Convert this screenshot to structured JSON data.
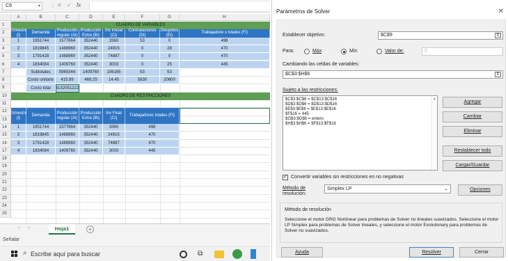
{
  "formula_bar": {
    "name_box": "C9",
    "fx": "fx"
  },
  "columns": [
    "A",
    "B",
    "C",
    "D",
    "E",
    "F",
    "G",
    "H"
  ],
  "rows": [
    "1",
    "2",
    "3",
    "4",
    "5",
    "6",
    "7",
    "8",
    "9",
    "10",
    "11",
    "12",
    "13",
    "14",
    "15",
    "16",
    "17",
    "18",
    "19",
    "20",
    "21",
    "22",
    "23",
    "24",
    "25"
  ],
  "table1": {
    "band": "CUADRO DE VARIABLES",
    "headers": [
      "Trimestre (i)",
      "Demanda",
      "Producción regular (Ai)",
      "Producción Extra (Bi)",
      "Inv Inicial (Ci)",
      "Contrataciones (Di)",
      "Despidos (Ei)",
      "Trabajadore s totales (Fi)"
    ],
    "rows": [
      [
        "1",
        "1951744",
        "1577664",
        "352440",
        "3360",
        "53",
        "0",
        "498"
      ],
      [
        "2",
        "1819845",
        "1488960",
        "352440",
        "24915",
        "0",
        "28",
        "470"
      ],
      [
        "3",
        "1791428",
        "1488960",
        "352440",
        "74887",
        "0",
        "0",
        "470"
      ],
      [
        "4",
        "1834084",
        "1409760",
        "352440",
        "3003",
        "0",
        "25",
        "445"
      ]
    ],
    "subtotal_label": "Subtotales",
    "subtotals": [
      "5965344",
      "1409760",
      "106165",
      "53",
      "53"
    ],
    "unit_cost_label": "Costo unitario",
    "unit_costs": [
      "415.89",
      "468.25",
      "14.45",
      "5830",
      "20600"
    ],
    "total_label": "Costo total",
    "total_value": "3132051222"
  },
  "table2": {
    "band": "CUADRO DE RESTRICCIONES",
    "headers": [
      "Trimestre (i)",
      "Demanda",
      "Producción regular (Ai)",
      "Producción Extra (Bi)",
      "Inv Final (Ci)",
      "Trabajadores totales (Fi)"
    ],
    "rows": [
      [
        "1",
        "1951744",
        "1577664",
        "352440",
        "3360",
        "498"
      ],
      [
        "2",
        "1819845",
        "1488960",
        "352440",
        "24915",
        "470"
      ],
      [
        "3",
        "1791428",
        "1488960",
        "352440",
        "74887",
        "470"
      ],
      [
        "4",
        "1834084",
        "1409760",
        "352440",
        "3003",
        "445"
      ]
    ]
  },
  "sheet": {
    "tab": "Hoja1",
    "add": "+",
    "status": "Señalar"
  },
  "taskbar": {
    "search": "Escribe aquí para buscar"
  },
  "solver": {
    "title": "Parámetros de Solver",
    "close": "✕",
    "objective_label": "Establecer objetivo:",
    "objective_value": "$C$9",
    "to_label": "Para:",
    "opt_max": "Máx",
    "opt_min": "Mín",
    "opt_value": "Valor de:",
    "value_of": "0",
    "changing_label": "Cambiando las celdas de variables:",
    "changing_value": "$C$3:$H$6",
    "constraints_label": "Sujeto a las restricciones:",
    "constraints": [
      "$C$3:$C$6 = $C$13:$C$16",
      "$D$3:$D$6 = $D$13:$D$16",
      "$E$3:$E$6 = $E$13:$E$16",
      "$F$16 = 445",
      "$G$3:$G$6 = entero",
      "$H$3:$H$6 = $F$13:$F$16"
    ],
    "btn_add": "Agregar",
    "btn_change": "Cambiar",
    "btn_delete": "Eliminar",
    "btn_reset": "Restablecer todo",
    "btn_load": "Cargar/Guardar",
    "nonneg_label": "Convertir variables sin restricciones en no negativas",
    "method_label_1": "Método de",
    "method_label_2": "resolución:",
    "method_value": "Simplex LP",
    "btn_options": "Opciones",
    "group_title": "Método de resolución",
    "group_desc": "Seleccione el motor GRG Nonlinear para problemas de Solver no lineales suavizados. Seleccione el motor LP Simplex para problemas de Solver lineales, y seleccione el motor Evolutionary para problemas de Solver no suavizados.",
    "btn_help": "Ayuda",
    "btn_solve": "Resolver",
    "btn_close": "Cerrar"
  }
}
